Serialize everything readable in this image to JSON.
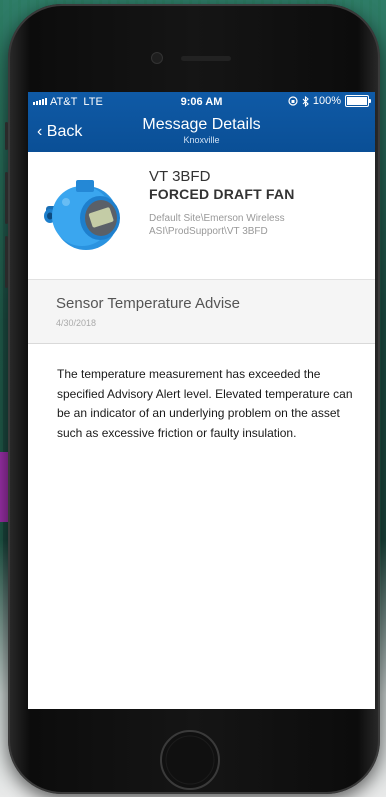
{
  "status_bar": {
    "carrier": "AT&T",
    "network": "LTE",
    "time": "9:06 AM",
    "battery": "100%",
    "battery_level": 1.0,
    "icons": [
      "orientation-lock-icon",
      "bluetooth-icon"
    ]
  },
  "nav": {
    "back_label": "Back",
    "title": "Message Details",
    "subtitle": "Knoxville"
  },
  "device": {
    "name": "VT 3BFD",
    "description": "FORCED DRAFT FAN",
    "path": "Default Site\\Emerson Wireless ASI\\ProdSupport\\VT 3BFD",
    "icon": "transmitter-icon"
  },
  "alert": {
    "title": "Sensor Temperature Advise",
    "date": "4/30/2018"
  },
  "message": {
    "text": "The temperature measurement has exceeded the specified Advisory Alert level. Elevated temperature can be an indicator of an underlying problem on the asset such as excessive friction or faulty insulation."
  },
  "colors": {
    "nav_bar": "#0d56a2",
    "alert_bg": "#f5f5f5",
    "device_blue": "#1f8fe0"
  }
}
